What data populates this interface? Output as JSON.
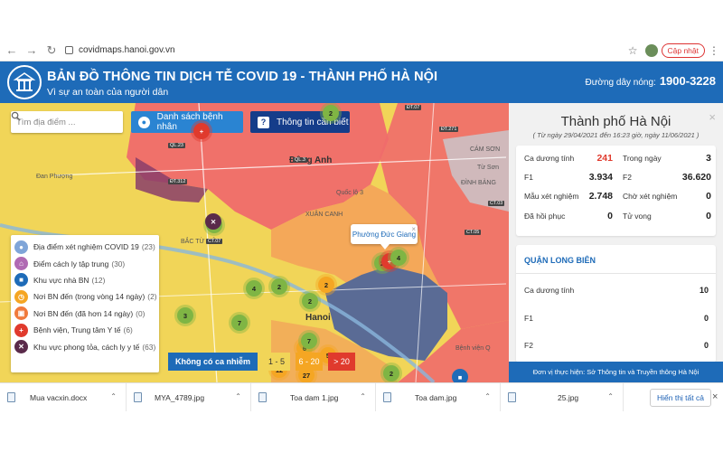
{
  "browser": {
    "url": "covidmaps.hanoi.gov.vn",
    "update_label": "Cập nhật"
  },
  "header": {
    "title": "BẢN ĐỒ THÔNG TIN DỊCH TỄ COVID 19 - THÀNH PHỐ HÀ NỘI",
    "subtitle": "Vì sự an toàn của người dân",
    "hotline_label": "Đường dây nóng:",
    "hotline_number": "1900-3228"
  },
  "toolbar": {
    "search_placeholder": "Tìm địa điểm ...",
    "patients_button": "Danh sách bệnh nhân",
    "info_button": "Thông tin cần biết"
  },
  "legend": {
    "items": [
      {
        "label": "Địa điểm xét nghiệm COVID 19",
        "count": "(23)",
        "color": "#7fa5d8"
      },
      {
        "label": "Điểm cách ly tập trung",
        "count": "(30)",
        "color": "#b06ab3"
      },
      {
        "label": "Khu vực nhà BN",
        "count": "(12)",
        "color": "#1e6bb8"
      },
      {
        "label": "Nơi BN đến (trong vòng 14 ngày)",
        "count": "(2)",
        "color": "#f5a623"
      },
      {
        "label": "Nơi BN đến (đã hơn 14 ngày)",
        "count": "(0)",
        "color": "#f07a3c"
      },
      {
        "label": "Bệnh viện, Trung tâm Y tế",
        "count": "(6)",
        "color": "#e03a2d"
      },
      {
        "label": "Khu vực phong tỏa, cách ly y tế",
        "count": "(63)",
        "color": "#5a2a4a"
      }
    ]
  },
  "map": {
    "popup_label": "Phường Đức Giang",
    "popup_close": "×",
    "scale_label": "Không có ca nhiễm",
    "scale_items": [
      {
        "label": "1 - 5",
        "bg": "#f1d558",
        "fg": "#333333"
      },
      {
        "label": "6 - 20",
        "bg": "#f5a623",
        "fg": "#ffffff"
      },
      {
        "label": "> 20",
        "bg": "#e03a2d",
        "fg": "#ffffff"
      }
    ],
    "places": {
      "dong_anh": "Đông Anh",
      "dan_phuong": "Đan Phượng",
      "hanoi": "Hanoi",
      "tu_son": "Từ Sơn",
      "dinh_bang": "ĐÌNH BẢNG",
      "cam_son": "CÁM SƠN",
      "quoc_lo_3": "Quốc lộ 3",
      "xuan_canh": "XUÂN CANH",
      "bac_tu_liem": "BẮC TỪ LIÊM",
      "benh_vien": "Bệnh viện Q"
    },
    "roads": [
      "ĐT.07",
      "ĐT.271",
      "QL.23",
      "ĐT.312",
      "QL.3",
      "CT.07",
      "CT.03",
      "CT.05"
    ],
    "clusters": [
      "2",
      "2",
      "4",
      "3",
      "7",
      "2",
      "2",
      "2",
      "4",
      "6",
      "5",
      "7",
      "12",
      "2",
      "27"
    ]
  },
  "panel": {
    "close": "×",
    "title": "Thành phố Hà Nội",
    "date_range": "( Từ ngày 29/04/2021 đến 16:23 giờ, ngày 11/06/2021 )",
    "stats": {
      "positive_label": "Ca dương tính",
      "positive": "241",
      "today_label": "Trong ngày",
      "today": "3",
      "f1_label": "F1",
      "f1": "3.934",
      "f2_label": "F2",
      "f2": "36.620",
      "negative_label": "Mẫu xét nghiệm",
      "negative": "2.748",
      "pending_label": "Chờ xét nghiệm",
      "pending": "0",
      "recovered_label": "Đã hồi phục",
      "recovered": "0",
      "deaths_label": "Tử vong",
      "deaths": "0"
    },
    "district": {
      "title": "QUẬN LONG BIÊN",
      "rows": [
        {
          "label": "Ca dương tính",
          "value": "10"
        },
        {
          "label": "F1",
          "value": "0"
        },
        {
          "label": "F2",
          "value": "0"
        }
      ]
    },
    "footer": "Đơn vị thực hiện: Sở Thông tin và Truyền thông Hà Nội"
  },
  "downloads": {
    "items": [
      "Mua vacxin.docx",
      "MYA_4789.jpg",
      "Toa dam 1.jpg",
      "Toa dam.jpg",
      "25.jpg"
    ],
    "show_all": "Hiển thị tất cả",
    "close": "×"
  }
}
